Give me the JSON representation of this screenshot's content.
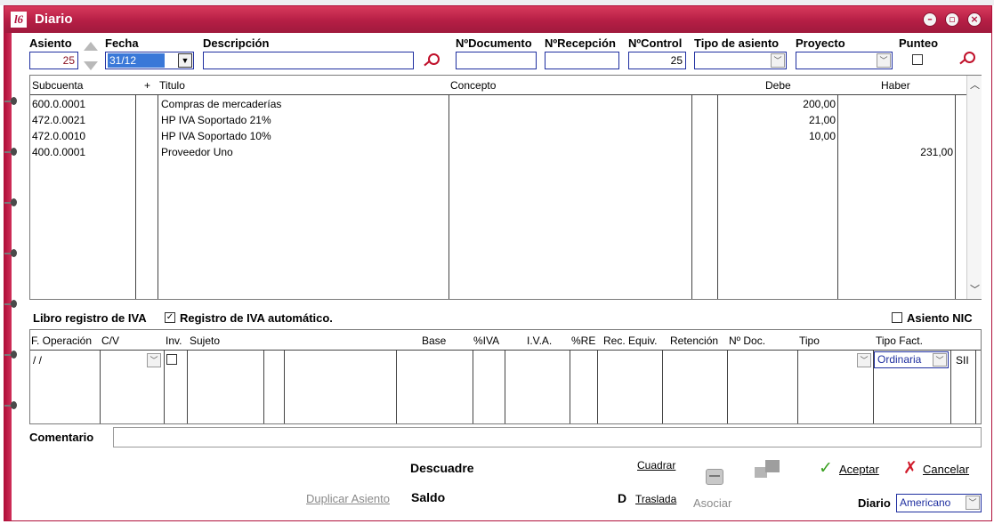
{
  "window": {
    "title": "Diario",
    "logo_text": "l6",
    "controls": [
      "minimize-icon",
      "restore-icon",
      "close-icon"
    ]
  },
  "header": {
    "asiento_label": "Asiento",
    "asiento_value": "25",
    "fecha_label": "Fecha",
    "fecha_value": "31/12",
    "descripcion_label": "Descripción",
    "descripcion_value": "",
    "documento_label": "NºDocumento",
    "documento_value": "",
    "recepcion_label": "NºRecepción",
    "recepcion_value": "",
    "control_label": "NºControl",
    "control_value": "25",
    "tipo_label": "Tipo de asiento",
    "tipo_value": "",
    "proyecto_label": "Proyecto",
    "proyecto_value": "",
    "punteo_label": "Punteo",
    "punteo_checked": false
  },
  "apuntes": {
    "columns": [
      "Subcuenta",
      "+",
      "Titulo",
      "Concepto",
      "Debe",
      "Haber"
    ],
    "rows": [
      {
        "subcuenta": "600.0.0001",
        "titulo": "Compras de mercaderías",
        "concepto": "",
        "debe": "200,00",
        "haber": ""
      },
      {
        "subcuenta": "472.0.0021",
        "titulo": "HP IVA Soportado 21%",
        "concepto": "",
        "debe": "21,00",
        "haber": ""
      },
      {
        "subcuenta": "472.0.0010",
        "titulo": "HP IVA Soportado 10%",
        "concepto": "",
        "debe": "10,00",
        "haber": ""
      },
      {
        "subcuenta": "400.0.0001",
        "titulo": "Proveedor Uno",
        "concepto": "",
        "debe": "",
        "haber": "231,00"
      }
    ]
  },
  "iva": {
    "libro_label": "Libro registro de IVA",
    "auto_label": "Registro de IVA automático.",
    "auto_checked": true,
    "nic_label": "Asiento NIC",
    "nic_checked": false,
    "columns": [
      "F. Operación",
      "C/V",
      "Inv.",
      "Sujeto",
      "Base",
      "%IVA",
      "I.V.A.",
      "%RE",
      "Rec. Equiv.",
      "Retención",
      "Nº Doc.",
      "Tipo",
      "Tipo Fact."
    ],
    "row": {
      "f_operacion": "/ /",
      "tipo_fact": "Ordinaria",
      "sii": "SII"
    }
  },
  "comentario": {
    "label": "Comentario",
    "value": ""
  },
  "footer": {
    "descuadre_label": "Descuadre",
    "saldo_label": "Saldo",
    "duplicar_label": "Duplicar Asiento",
    "cuadrar_label": "Cuadrar",
    "d_label": "D",
    "traslada_label": "Traslada",
    "asociar_label": "Asociar",
    "aceptar_label": "Aceptar",
    "cancelar_label": "Cancelar",
    "diario_label": "Diario",
    "diario_value": "Americano"
  },
  "colors": {
    "accent": "#b0103a",
    "field_border": "#1f2fa0",
    "date_highlight": "#3a78d8"
  }
}
